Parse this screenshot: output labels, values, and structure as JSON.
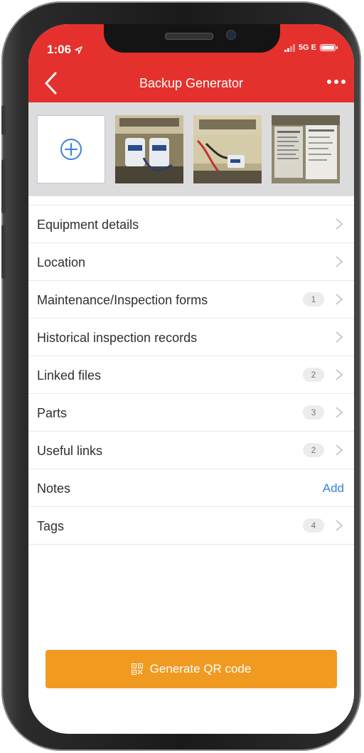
{
  "status_bar": {
    "time": "1:06",
    "network": "5G E"
  },
  "nav": {
    "title": "Backup Generator"
  },
  "gallery": {
    "add_icon": "plus-circle-icon",
    "photos": [
      "generator-filters-photo",
      "generator-engine-photo",
      "generator-label-photo"
    ]
  },
  "list": [
    {
      "label": "Equipment details",
      "badge": null
    },
    {
      "label": "Location",
      "badge": null
    },
    {
      "label": "Maintenance/Inspection forms",
      "badge": "1"
    },
    {
      "label": "Historical inspection records",
      "badge": null
    },
    {
      "label": "Linked files",
      "badge": "2"
    },
    {
      "label": "Parts",
      "badge": "3"
    },
    {
      "label": "Useful links",
      "badge": "2"
    },
    {
      "label": "Notes",
      "action": "Add"
    },
    {
      "label": "Tags",
      "badge": "4"
    }
  ],
  "qr_button": {
    "label": "Generate QR code",
    "icon": "qr-code-icon"
  },
  "colors": {
    "header": "#e5312d",
    "button": "#f19a22",
    "link": "#3b82d8"
  }
}
